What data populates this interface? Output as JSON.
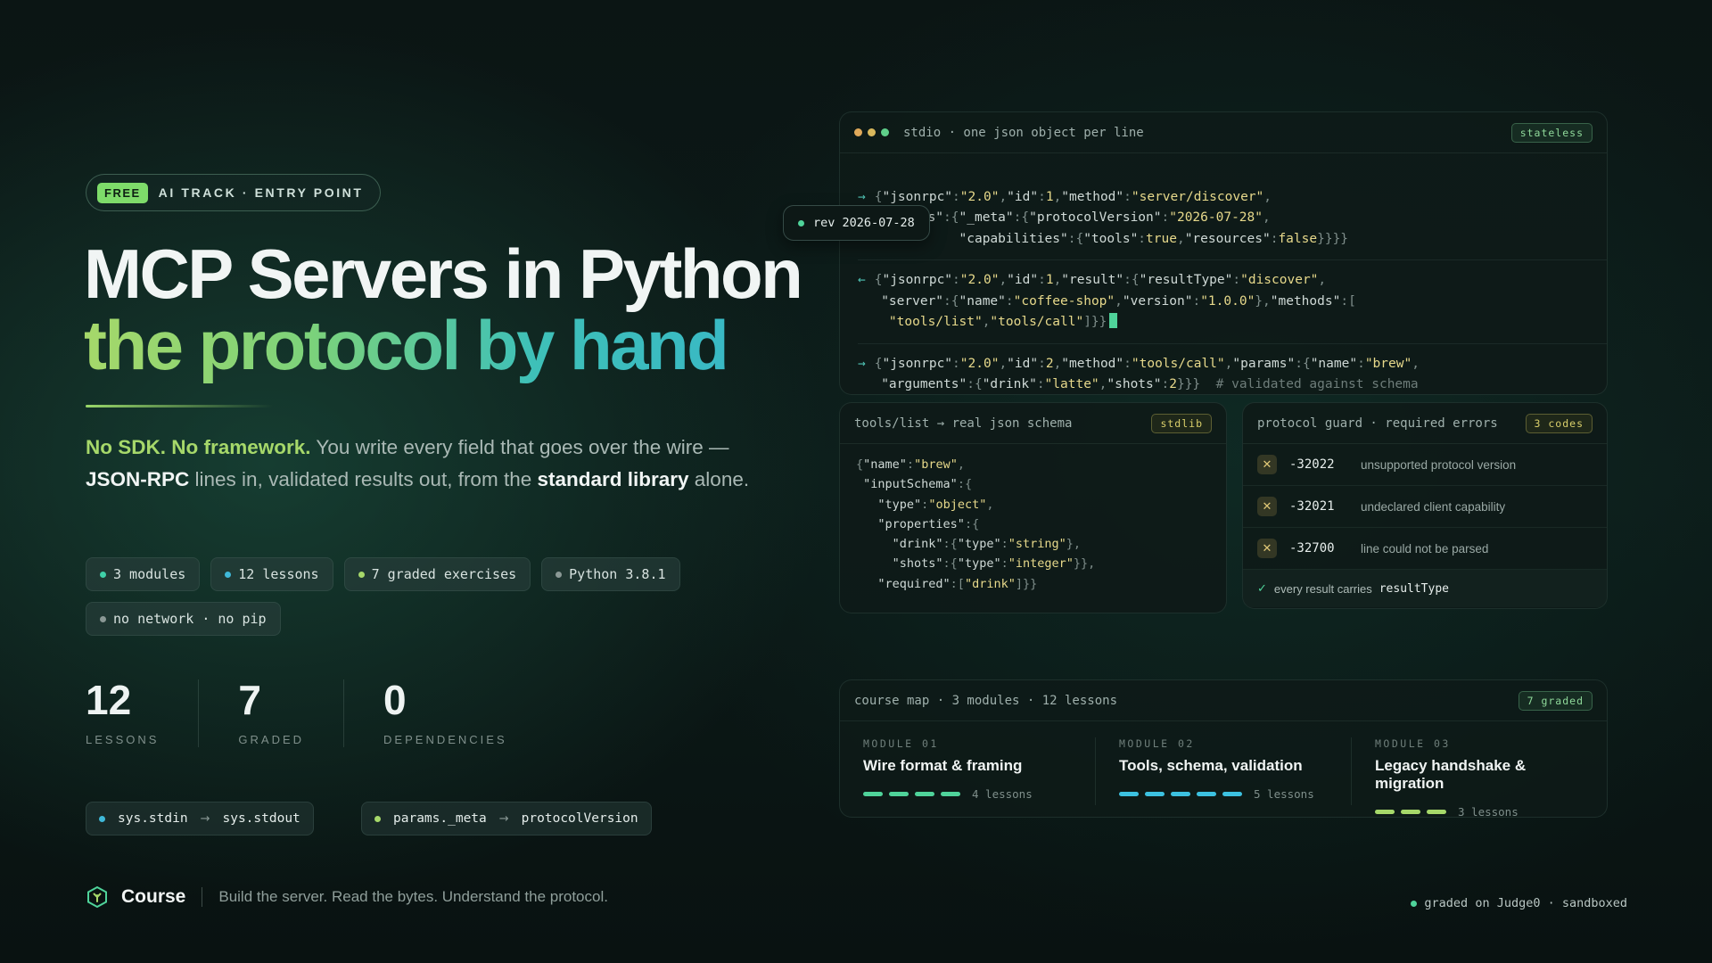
{
  "hero": {
    "badge_tag": "FREE",
    "badge_text": "AI TRACK · ENTRY POINT",
    "title_line1": "MCP Servers in Python",
    "title_line2": "the protocol by hand",
    "lede_highlight": "No SDK. No framework.",
    "lede_part1": " You write every field that goes over the wire — ",
    "lede_strong1": "JSON-RPC",
    "lede_part2": " lines in, validated results out, from the ",
    "lede_strong2": "standard library",
    "lede_part3": " alone."
  },
  "chips": [
    {
      "label": "3 modules",
      "dot_color": "#3fd0a8"
    },
    {
      "label": "12 lessons",
      "dot_color": "#3fb8d8"
    },
    {
      "label": "7 graded exercises",
      "dot_color": "#a6d86a"
    },
    {
      "label": "Python 3.8.1",
      "dot_color": "#8a9895"
    },
    {
      "label": "no network · no pip",
      "dot_color": "#8a9895"
    }
  ],
  "stats": [
    {
      "value": "12",
      "label": "LESSONS"
    },
    {
      "value": "7",
      "label": "GRADED"
    },
    {
      "value": "0",
      "label": "DEPENDENCIES"
    }
  ],
  "flows": [
    {
      "from": "sys.stdin",
      "arrow": "→",
      "to": "sys.stdout",
      "dot_color": "#3fb8d8"
    },
    {
      "from": "params._meta",
      "arrow": "→",
      "to": "protocolVersion",
      "dot_color": "#a6d86a"
    }
  ],
  "footer": {
    "course_label": "Course",
    "tagline": "Build the server. Read the bytes. Understand the protocol.",
    "status": "graded on Judge0 · sandboxed"
  },
  "transcript": {
    "title": "stdio · one json object per line",
    "tag": "stateless",
    "rev_label": "rev 2026-07-28"
  },
  "schema_panel": {
    "title": "tools/list → real json schema",
    "tag": "stdlib"
  },
  "guard_panel": {
    "title": "protocol guard · required errors",
    "tag": "3 codes",
    "errors": [
      {
        "code": "-32022",
        "desc": "unsupported protocol version"
      },
      {
        "code": "-32021",
        "desc": "undeclared client capability"
      },
      {
        "code": "-32700",
        "desc": "line could not be parsed"
      }
    ],
    "foot_text": "every result carries",
    "foot_code": "resultType"
  },
  "course_map": {
    "title": "course map · 3 modules · 12 lessons",
    "tag": "7 graded",
    "modules": [
      {
        "kicker": "MODULE 01",
        "title": "Wire format & framing",
        "lessons": "4 lessons",
        "segments": 4,
        "color": "#4fd39a"
      },
      {
        "kicker": "MODULE 02",
        "title": "Tools, schema, validation",
        "lessons": "5 lessons",
        "segments": 5,
        "color": "#3cc1e0"
      },
      {
        "kicker": "MODULE 03",
        "title": "Legacy handshake & migration",
        "lessons": "3 lessons",
        "segments": 3,
        "color": "#a6d86a"
      }
    ]
  },
  "colors": {
    "accent_green": "#a6d86a",
    "accent_teal": "#3ec0b8",
    "string_yellow": "#e7d98b"
  }
}
